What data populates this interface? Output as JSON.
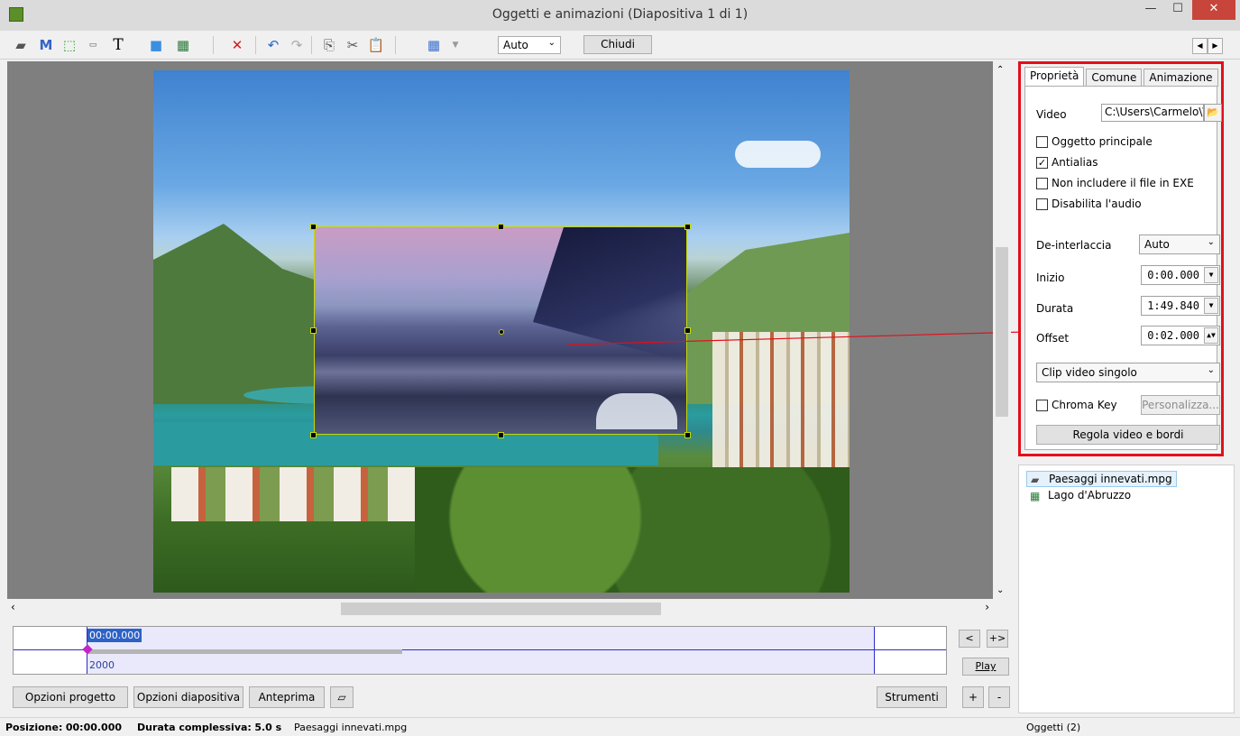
{
  "window": {
    "title": "Oggetti e animazioni  (Diapositiva 1 di 1)"
  },
  "toolbar": {
    "auto_select": "Auto",
    "close_label": "Chiudi"
  },
  "panel": {
    "tabs": [
      "Proprietà",
      "Comune",
      "Animazione"
    ],
    "video_label": "Video",
    "video_path": "C:\\Users\\Carmelo\\\\",
    "checkboxes": [
      {
        "label": "Oggetto principale",
        "checked": false
      },
      {
        "label": "Antialias",
        "checked": true
      },
      {
        "label": "Non includere il file in EXE",
        "checked": false
      },
      {
        "label": "Disabilita l'audio",
        "checked": false
      }
    ],
    "deinterlace_label": "De-interlaccia",
    "deinterlace_value": "Auto",
    "start_label": "Inizio",
    "start_value": "0:00.000",
    "duration_label": "Durata",
    "duration_value": "1:49.840",
    "offset_label": "Offset",
    "offset_value": "0:02.000",
    "clip_mode": "Clip video singolo",
    "chroma_label": "Chroma Key",
    "customize_label": "Personalizza...",
    "adjust_label": "Regola video e bordi"
  },
  "objects": {
    "items": [
      "Paesaggi innevati.mpg",
      "Lago d'Abruzzo"
    ],
    "count_label": "Oggetti (2)"
  },
  "timeline": {
    "time": "00:00.000",
    "marker_label": "2000",
    "prev_label": "<",
    "next_label": "+>",
    "play_label": "Play"
  },
  "bottom": {
    "project_options": "Opzioni progetto",
    "slide_options": "Opzioni diapositiva",
    "preview": "Anteprima",
    "tools": "Strumenti",
    "plus": "+",
    "minus": "-"
  },
  "status": {
    "position_label": "Posizione:",
    "position_value": "00:00.000",
    "total_label": "Durata complessiva:",
    "total_value": "5.0 s",
    "filename": "Paesaggi innevati.mpg"
  },
  "colors": {
    "highlight_border": "#e40e1b",
    "selection_handle": "#c8d800",
    "timeline_accent": "#2d2dc8"
  }
}
